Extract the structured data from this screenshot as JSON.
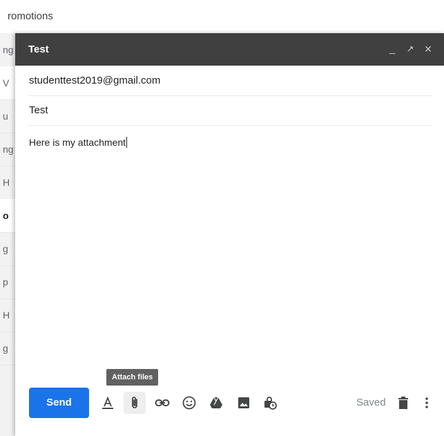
{
  "background": {
    "tab_title": "romotions",
    "rows": [
      "ng",
      "V",
      "u",
      "ng",
      "H",
      "o",
      "g",
      "p",
      "H",
      "g"
    ]
  },
  "compose": {
    "title": "Test",
    "minimize_label": "_",
    "expand_label": "↗",
    "close_label": "×",
    "recipient": "studenttest2019@gmail.com",
    "subject": "Test",
    "body": "Here is my attachment"
  },
  "toolbar": {
    "send_label": "Send",
    "attach_tooltip": "Attach files",
    "saved_label": "Saved"
  },
  "colors": {
    "send_button": "#1a73e8",
    "title_bar": "#404040",
    "icon": "#444746"
  },
  "icons": [
    "format-text-icon",
    "attach-icon",
    "link-icon",
    "emoji-icon",
    "drive-icon",
    "photo-icon",
    "confidential-mode-icon",
    "trash-icon",
    "more-options-icon"
  ]
}
